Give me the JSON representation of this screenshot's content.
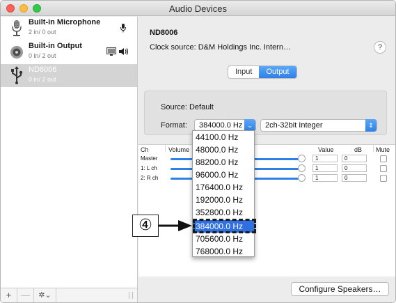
{
  "window": {
    "title": "Audio Devices"
  },
  "sidebar": {
    "devices": [
      {
        "name": "Built-in Microphone",
        "io": "2 in/ 0 out",
        "icon": "microphone-icon"
      },
      {
        "name": "Built-in Output",
        "io": "0 in/ 2 out",
        "icon": "speaker-icon"
      },
      {
        "name": "ND8006",
        "io": "0 in/ 2 out",
        "icon": "usb-icon",
        "selected": true
      }
    ],
    "footer": {
      "add": "+",
      "remove": "—",
      "gear": "✲⌄"
    }
  },
  "main": {
    "device_title": "ND8006",
    "clock_source": "Clock source: D&M Holdings Inc. Intern…",
    "help": "?",
    "tabs": {
      "input": "Input",
      "output": "Output",
      "active": "Output"
    },
    "source_label": "Source:",
    "source_value": "Default",
    "format_label": "Format:",
    "format_value": "384000.0 Hz",
    "bit_format": "2ch-32bit Integer",
    "table": {
      "headers": {
        "ch": "Ch",
        "volume": "Volume",
        "value": "Value",
        "db": "dB",
        "mute": "Mute"
      },
      "rows": [
        {
          "ch": "Master",
          "value": "1",
          "db": "0"
        },
        {
          "ch": "1: L ch",
          "value": "1",
          "db": "0"
        },
        {
          "ch": "2: R ch",
          "value": "1",
          "db": "0"
        }
      ]
    },
    "configure_button": "Configure Speakers…"
  },
  "dropdown": {
    "options": [
      "44100.0 Hz",
      "48000.0 Hz",
      "88200.0 Hz",
      "96000.0 Hz",
      "176400.0 Hz",
      "192000.0 Hz",
      "352800.0 Hz",
      "384000.0 Hz",
      "705600.0 Hz",
      "768000.0 Hz"
    ],
    "selected": "384000.0 Hz"
  },
  "annotation": {
    "callout": "④"
  },
  "colors": {
    "accent": "#2f7fe8",
    "selection": "#2f6fdf"
  }
}
